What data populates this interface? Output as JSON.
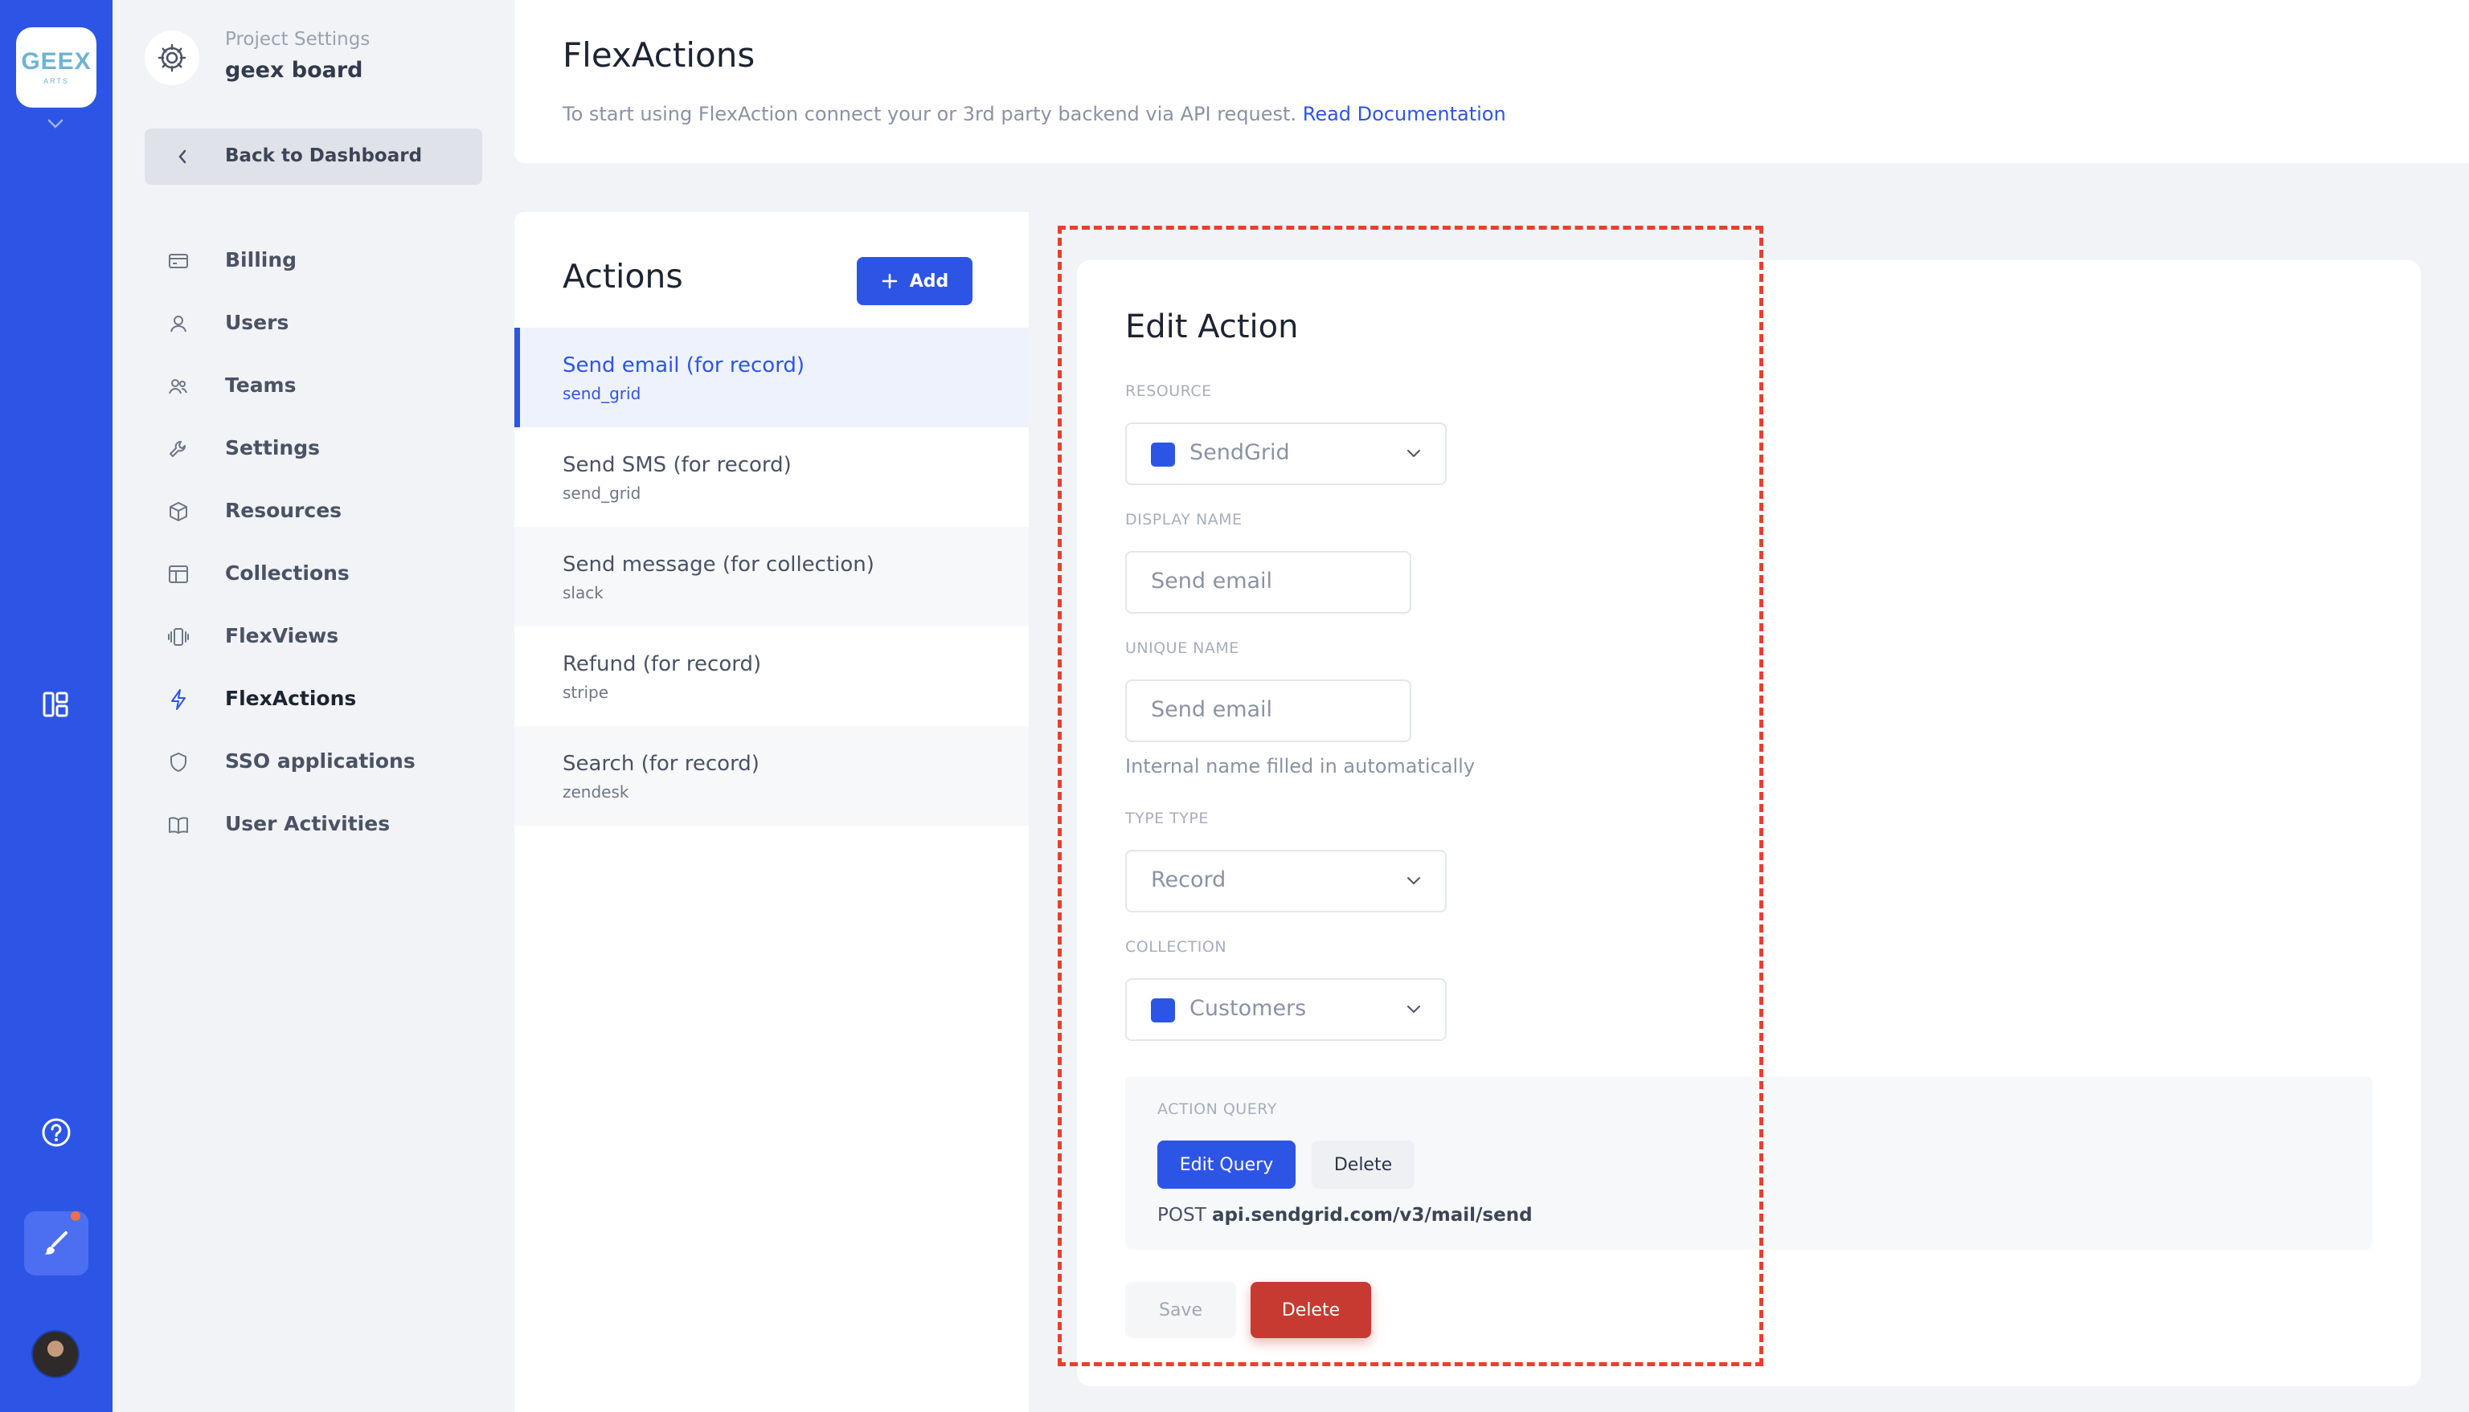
{
  "rail": {
    "logo_text": "GEEX",
    "logo_sub": "ARTS"
  },
  "sidebar": {
    "project_label": "Project Settings",
    "project_name": "geex board",
    "back_label": "Back to Dashboard",
    "items": [
      {
        "label": "Billing",
        "icon": "credit-card-icon"
      },
      {
        "label": "Users",
        "icon": "user-icon"
      },
      {
        "label": "Teams",
        "icon": "users-icon"
      },
      {
        "label": "Settings",
        "icon": "tool-icon"
      },
      {
        "label": "Resources",
        "icon": "cube-icon"
      },
      {
        "label": "Collections",
        "icon": "table-icon"
      },
      {
        "label": "FlexViews",
        "icon": "views-icon"
      },
      {
        "label": "FlexActions",
        "icon": "lightning-icon",
        "active": true
      },
      {
        "label": "SSO applications",
        "icon": "shield-icon"
      },
      {
        "label": "User Activities",
        "icon": "book-icon"
      }
    ]
  },
  "header": {
    "title": "FlexActions",
    "description": "To start using FlexAction connect your or 3rd party backend via API request.",
    "doc_link": "Read Documentation"
  },
  "actions": {
    "title": "Actions",
    "add_label": "Add",
    "items": [
      {
        "name": "Send email (for record)",
        "sub": "send_grid",
        "active": true
      },
      {
        "name": "Send SMS (for record)",
        "sub": "send_grid"
      },
      {
        "name": "Send message (for collection)",
        "sub": "slack"
      },
      {
        "name": "Refund (for record)",
        "sub": "stripe"
      },
      {
        "name": "Search (for record)",
        "sub": "zendesk"
      }
    ]
  },
  "edit": {
    "title": "Edit Action",
    "resource_label": "RESOURCE",
    "resource_value": "SendGrid",
    "display_name_label": "DISPLAY NAME",
    "display_name_value": "Send email",
    "unique_name_label": "UNIQUE NAME",
    "unique_name_value": "Send email",
    "unique_hint": "Internal name filled in automatically",
    "type_label": "TYPE TYPE",
    "type_value": "Record",
    "collection_label": "COLLECTION",
    "collection_value": "Customers",
    "query_label": "ACTION QUERY",
    "edit_query_label": "Edit Query",
    "query_delete_label": "Delete",
    "method": "POST",
    "endpoint": "api.sendgrid.com/v3/mail/send",
    "save_label": "Save",
    "delete_label": "Delete"
  },
  "colors": {
    "accent": "#2d55e5",
    "danger": "#c73a32",
    "highlight": "#e8402f"
  }
}
